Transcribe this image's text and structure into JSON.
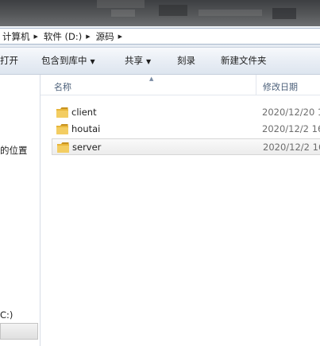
{
  "address": {
    "crumbs": [
      "计算机",
      "软件 (D:)",
      "源码"
    ]
  },
  "toolbar": {
    "open": "打开",
    "include_library": "包含到库中",
    "share": "共享",
    "burn": "刻录",
    "new_folder": "新建文件夹"
  },
  "nav": {
    "locations_fragment": "的位置",
    "drive_fragment": "C:)"
  },
  "columns": {
    "name": "名称",
    "date_modified": "修改日期"
  },
  "files": [
    {
      "name": "client",
      "date": "2020/12/20 1",
      "icon": "folder-icon"
    },
    {
      "name": "houtai",
      "date": "2020/12/2 16",
      "icon": "folder-icon"
    },
    {
      "name": "server",
      "date": "2020/12/2 16",
      "icon": "folder-icon",
      "selected": true
    }
  ],
  "colors": {
    "folder": "#e8b63a",
    "title_bg": "#4a4c4f",
    "toolbar_bg": "#e9eef5",
    "header_text": "#4c607a"
  }
}
